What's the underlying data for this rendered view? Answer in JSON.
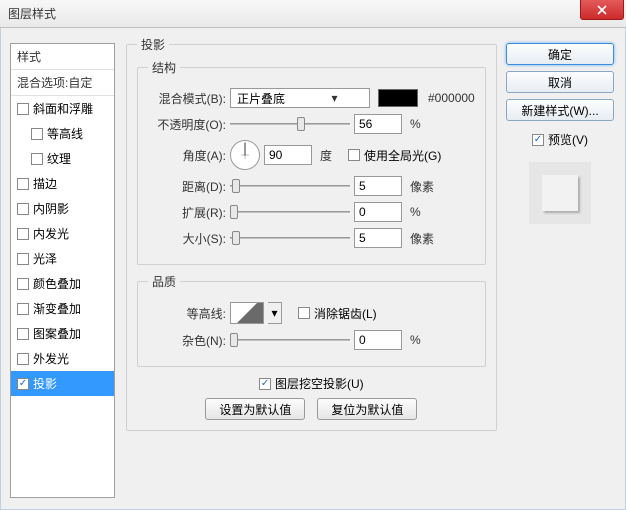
{
  "window": {
    "title": "图层样式"
  },
  "sidebar": {
    "header": "样式",
    "blend_options": "混合选项:自定",
    "items": [
      {
        "label": "斜面和浮雕",
        "checked": false,
        "indent": false,
        "selected": false
      },
      {
        "label": "等高线",
        "checked": false,
        "indent": true,
        "selected": false
      },
      {
        "label": "纹理",
        "checked": false,
        "indent": true,
        "selected": false
      },
      {
        "label": "描边",
        "checked": false,
        "indent": false,
        "selected": false
      },
      {
        "label": "内阴影",
        "checked": false,
        "indent": false,
        "selected": false
      },
      {
        "label": "内发光",
        "checked": false,
        "indent": false,
        "selected": false
      },
      {
        "label": "光泽",
        "checked": false,
        "indent": false,
        "selected": false
      },
      {
        "label": "颜色叠加",
        "checked": false,
        "indent": false,
        "selected": false
      },
      {
        "label": "渐变叠加",
        "checked": false,
        "indent": false,
        "selected": false
      },
      {
        "label": "图案叠加",
        "checked": false,
        "indent": false,
        "selected": false
      },
      {
        "label": "外发光",
        "checked": false,
        "indent": false,
        "selected": false
      },
      {
        "label": "投影",
        "checked": true,
        "indent": false,
        "selected": true
      }
    ]
  },
  "panel": {
    "title": "投影",
    "structure": {
      "legend": "结构",
      "blend_mode_label": "混合模式(B):",
      "blend_mode_value": "正片叠底",
      "color": "#000000",
      "opacity_label": "不透明度(O):",
      "opacity_value": "56",
      "opacity_unit": "%",
      "angle_label": "角度(A):",
      "angle_value": "90",
      "angle_unit": "度",
      "global_light_label": "使用全局光(G)",
      "global_light_checked": false,
      "distance_label": "距离(D):",
      "distance_value": "5",
      "distance_unit": "像素",
      "spread_label": "扩展(R):",
      "spread_value": "0",
      "spread_unit": "%",
      "size_label": "大小(S):",
      "size_value": "5",
      "size_unit": "像素"
    },
    "quality": {
      "legend": "品质",
      "contour_label": "等高线:",
      "antialias_label": "消除锯齿(L)",
      "antialias_checked": false,
      "noise_label": "杂色(N):",
      "noise_value": "0",
      "noise_unit": "%"
    },
    "knockout": {
      "label": "图层挖空投影(U)",
      "checked": true
    },
    "buttons": {
      "default": "设置为默认值",
      "reset": "复位为默认值"
    }
  },
  "right": {
    "ok": "确定",
    "cancel": "取消",
    "new_style": "新建样式(W)...",
    "preview_label": "预览(V)",
    "preview_checked": true
  }
}
